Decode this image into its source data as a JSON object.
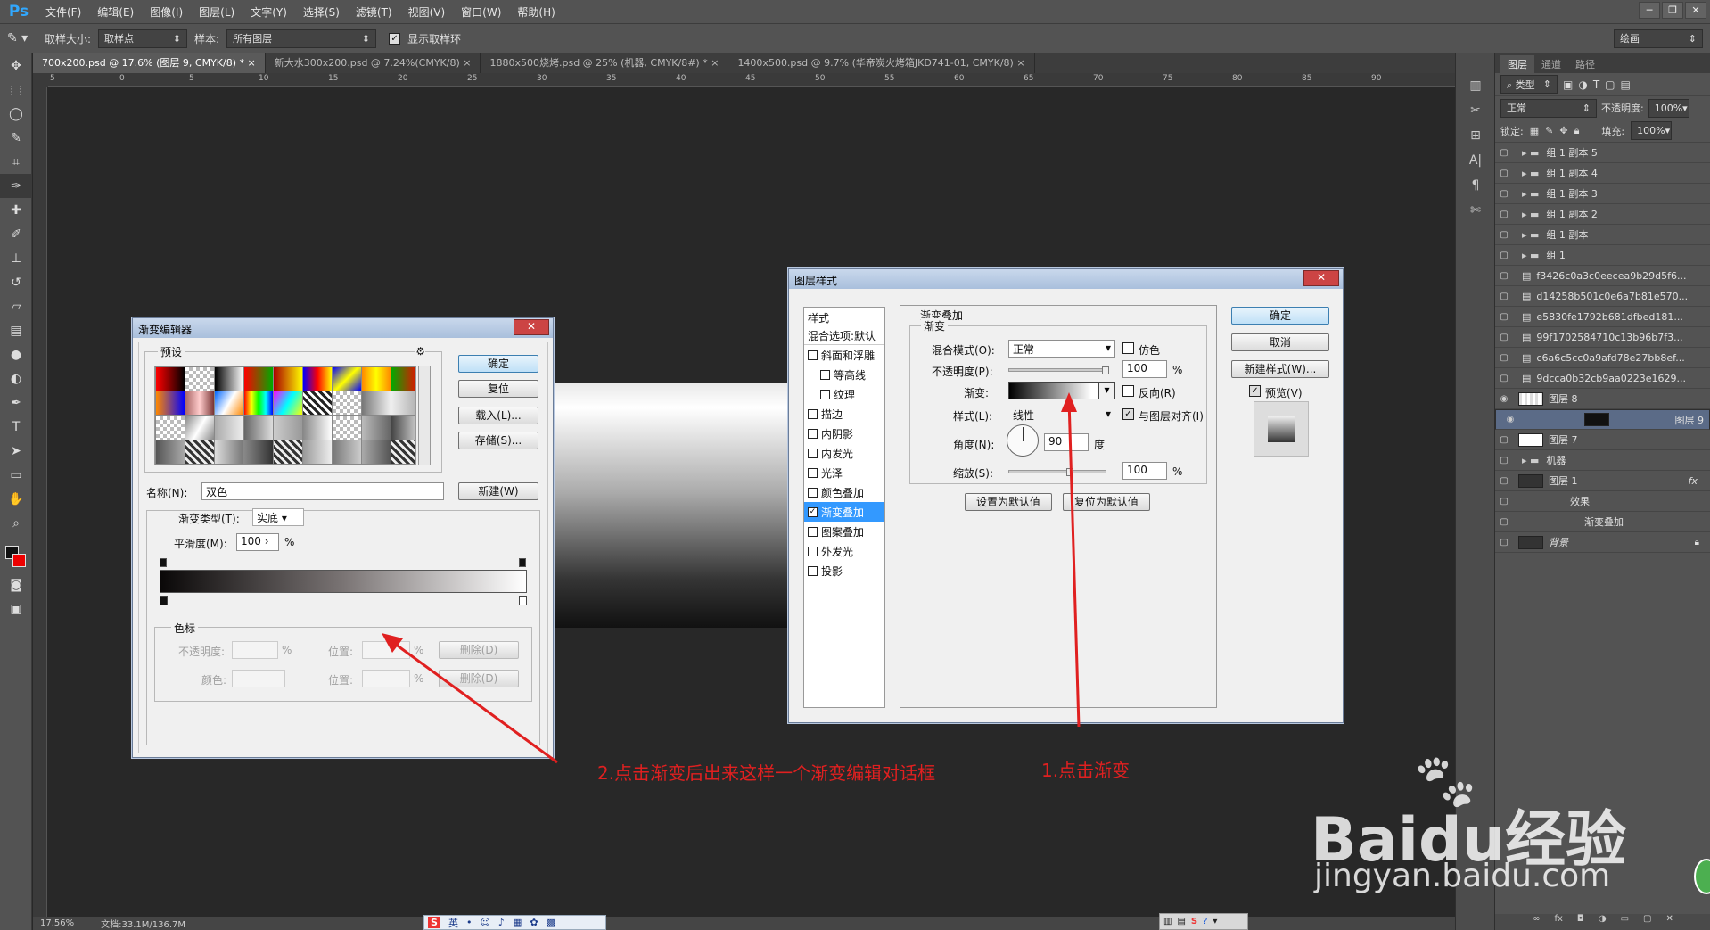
{
  "app": {
    "logo": "Ps",
    "menus": [
      "文件(F)",
      "编辑(E)",
      "图像(I)",
      "图层(L)",
      "文字(Y)",
      "选择(S)",
      "滤镜(T)",
      "视图(V)",
      "窗口(W)",
      "帮助(H)"
    ]
  },
  "options": {
    "sample_size_label": "取样大小:",
    "sample_size_value": "取样点",
    "sample_label": "样本:",
    "sample_value": "所有图层",
    "show_ring_label": "显示取样环",
    "workspace": "绘画"
  },
  "tabs": [
    "700x200.psd @ 17.6% (图层 9, CMYK/8) *",
    "新大水300x200.psd @ 7.24%(CMYK/8)",
    "1880x500烧烤.psd @ 25% (机器, CMYK/8#) *",
    "1400x500.psd @ 9.7% (华帝炭火烤箱JKD741-01, CMYK/8)"
  ],
  "ruler_top": [
    "5",
    "0",
    "5",
    "10",
    "15",
    "20",
    "25",
    "30",
    "35",
    "40",
    "45",
    "50",
    "55",
    "60",
    "65",
    "70",
    "75",
    "80",
    "85",
    "90"
  ],
  "status": {
    "zoom": "17.56%",
    "doc": "文档:33.1M/136.7M"
  },
  "layers_panel": {
    "tabs": [
      "图层",
      "通道",
      "路径"
    ],
    "filter": "类型",
    "blend": "正常",
    "opacity_label": "不透明度:",
    "opacity": "100%",
    "lock_label": "锁定:",
    "fill_label": "填充:",
    "fill": "100%",
    "layers": [
      {
        "name": "组 1 副本 5",
        "type": "group"
      },
      {
        "name": "组 1 副本 4",
        "type": "group"
      },
      {
        "name": "组 1 副本 3",
        "type": "group"
      },
      {
        "name": "组 1 副本 2",
        "type": "group"
      },
      {
        "name": "组 1 副本",
        "type": "group"
      },
      {
        "name": "组 1",
        "type": "group"
      },
      {
        "name": "f3426c0a3c0eecea9b29d5f6...",
        "type": "smart"
      },
      {
        "name": "d14258b501c0e6a7b81e570...",
        "type": "smart"
      },
      {
        "name": "e5830fe1792b681dfbed181...",
        "type": "smart"
      },
      {
        "name": "99f1702584710c13b96b7f3...",
        "type": "smart"
      },
      {
        "name": "c6a6c5cc0a9afd78e27bb8ef...",
        "type": "smart"
      },
      {
        "name": "9dcca0b32cb9aa0223e1629...",
        "type": "smart"
      },
      {
        "name": "图层 8",
        "type": "layer"
      },
      {
        "name": "图层 9",
        "type": "layer"
      },
      {
        "name": "图层 7",
        "type": "layer"
      },
      {
        "name": "机器",
        "type": "group"
      },
      {
        "name": "图层 1",
        "type": "layer"
      },
      {
        "name": "效果",
        "type": "fx"
      },
      {
        "name": "渐变叠加",
        "type": "fx"
      },
      {
        "name": "背景",
        "type": "bg"
      }
    ]
  },
  "gradient_editor": {
    "title": "渐变编辑器",
    "presets_label": "预设",
    "ok": "确定",
    "reset": "复位",
    "load": "载入(L)...",
    "save": "存储(S)...",
    "name_label": "名称(N):",
    "name_value": "双色",
    "new": "新建(W)",
    "type_label": "渐变类型(T):",
    "type_value": "实底",
    "smooth_label": "平滑度(M):",
    "smooth_value": "100",
    "smooth_unit": "%",
    "stops_label": "色标",
    "opacity_label": "不透明度:",
    "location_label": "位置:",
    "color_label": "颜色:",
    "delete": "删除(D)",
    "percent": "%"
  },
  "layer_style": {
    "title": "图层样式",
    "styles_header": "样式",
    "blend_options": "混合选项:默认",
    "effects": [
      {
        "name": "斜面和浮雕",
        "checked": false
      },
      {
        "name": "等高线",
        "checked": false
      },
      {
        "name": "纹理",
        "checked": false
      },
      {
        "name": "描边",
        "checked": false
      },
      {
        "name": "内阴影",
        "checked": false
      },
      {
        "name": "内发光",
        "checked": false
      },
      {
        "name": "光泽",
        "checked": false
      },
      {
        "name": "颜色叠加",
        "checked": false
      },
      {
        "name": "渐变叠加",
        "checked": true
      },
      {
        "name": "图案叠加",
        "checked": false
      },
      {
        "name": "外发光",
        "checked": false
      },
      {
        "name": "投影",
        "checked": false
      }
    ],
    "section_title": "渐变叠加",
    "group_title": "渐变",
    "blend_label": "混合模式(O):",
    "blend_value": "正常",
    "dither": "仿色",
    "opacity_label": "不透明度(P):",
    "opacity_value": "100",
    "gradient_label": "渐变:",
    "reverse": "反向(R)",
    "style_label": "样式(L):",
    "style_value": "线性",
    "align": "与图层对齐(I)",
    "angle_label": "角度(N):",
    "angle_value": "90",
    "angle_unit": "度",
    "scale_label": "缩放(S):",
    "scale_value": "100",
    "percent": "%",
    "set_default": "设置为默认值",
    "reset_default": "复位为默认值",
    "ok": "确定",
    "cancel": "取消",
    "new_style": "新建样式(W)...",
    "preview": "预览(V)"
  },
  "annotations": {
    "step2": "2.点击渐变后出来这样一个渐变编辑对话框",
    "step1": "1.点击渐变"
  },
  "watermark": {
    "brand": "Baidu经验",
    "url": "jingyan.baidu.com"
  },
  "taskbar": {
    "ime": "英"
  },
  "colors": {
    "accent": "#e02020",
    "panel": "#535353",
    "canvas": "#282828",
    "selected": "#5b6b87"
  }
}
